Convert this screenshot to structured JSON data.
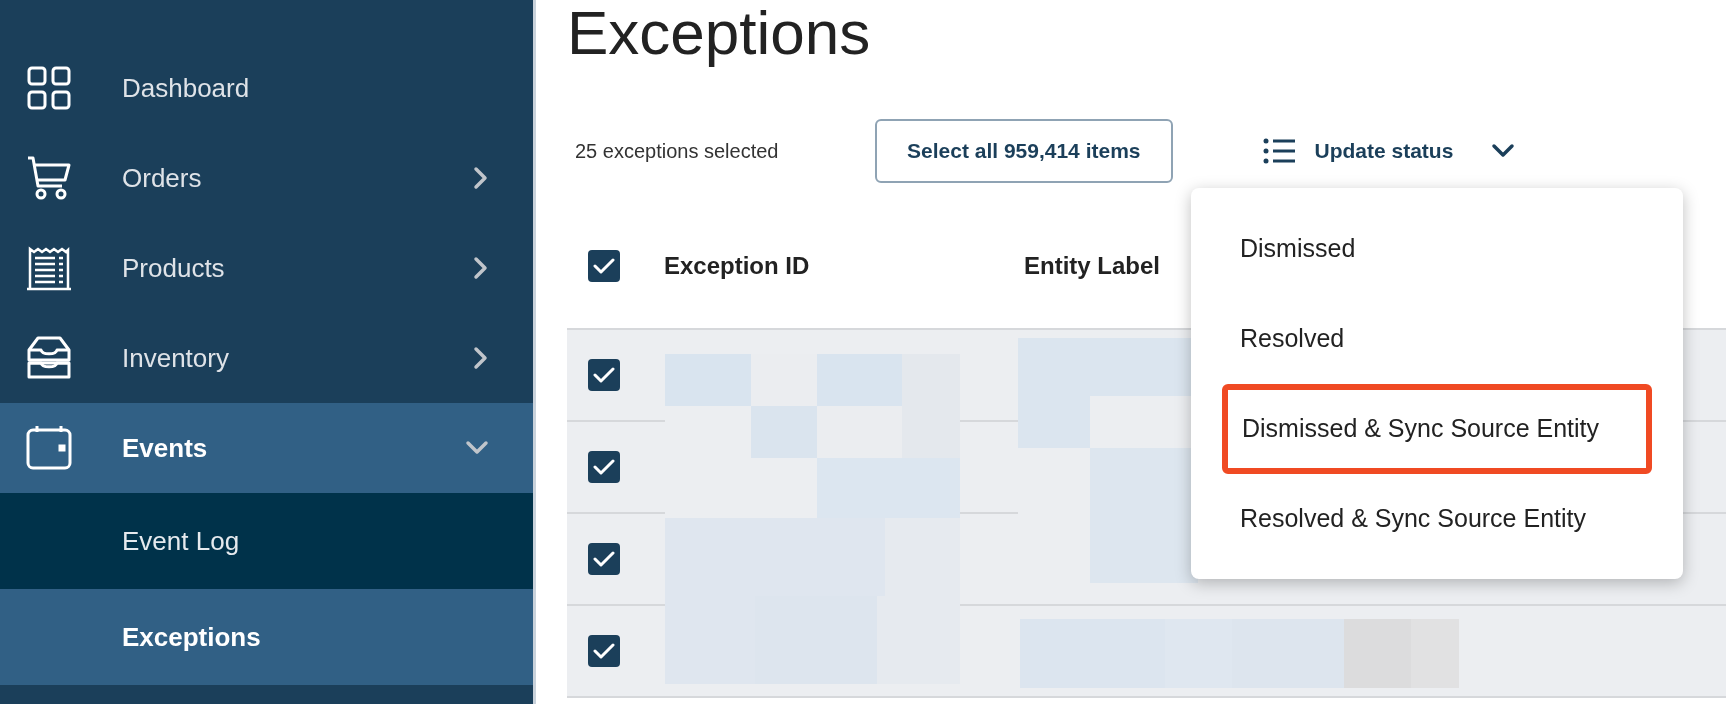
{
  "sidebar": {
    "items": [
      {
        "label": "Dashboard",
        "kind": "link",
        "selected": false
      },
      {
        "label": "Orders",
        "kind": "group",
        "expanded": false,
        "selected": false
      },
      {
        "label": "Products",
        "kind": "group",
        "expanded": false,
        "selected": false
      },
      {
        "label": "Inventory",
        "kind": "group",
        "expanded": false,
        "selected": false
      },
      {
        "label": "Events",
        "kind": "group",
        "expanded": true,
        "selected": true,
        "children": [
          {
            "label": "Event Log",
            "selected": false
          },
          {
            "label": "Exceptions",
            "selected": true
          }
        ]
      }
    ]
  },
  "page": {
    "title": "Exceptions"
  },
  "toolbar": {
    "selection_count": "25 exceptions selected",
    "select_all_button": "Select all 959,414 items",
    "update_status": {
      "label": "Update status",
      "expanded": true
    }
  },
  "status_menu": {
    "items": [
      {
        "label": "Dismissed",
        "highlighted": false
      },
      {
        "label": "Resolved",
        "highlighted": false
      },
      {
        "label": "Dismissed & Sync Source Entity",
        "highlighted": true
      },
      {
        "label": "Resolved & Sync Source Entity",
        "highlighted": false
      }
    ]
  },
  "table": {
    "header_checked": true,
    "columns": [
      {
        "label": "Exception ID"
      },
      {
        "label": "Entity Label"
      }
    ],
    "rows": [
      {
        "checked": true
      },
      {
        "checked": true
      },
      {
        "checked": true
      },
      {
        "checked": true
      }
    ]
  }
}
